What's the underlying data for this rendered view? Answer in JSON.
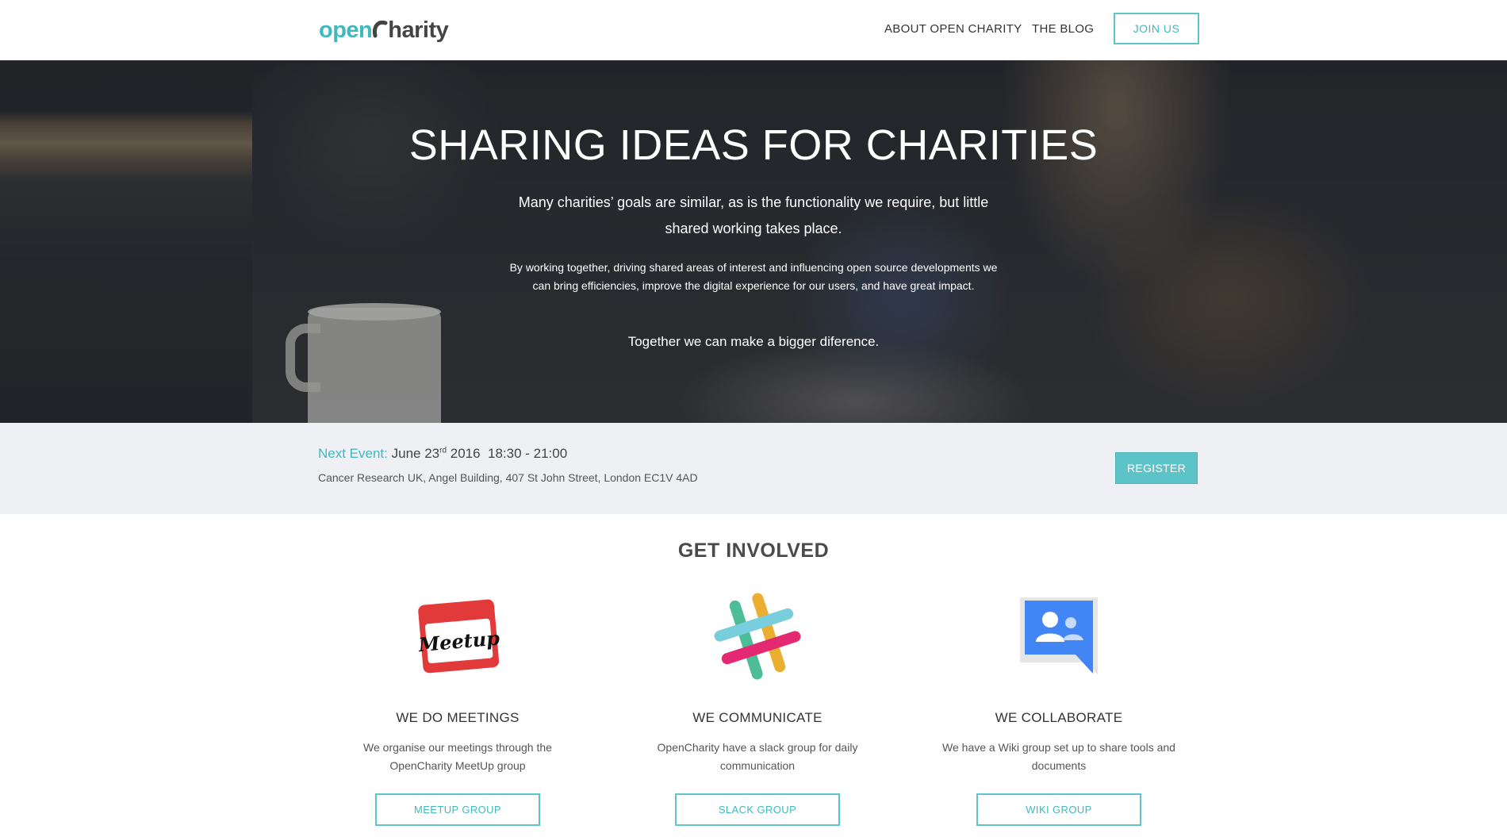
{
  "header": {
    "logo_part1": "open",
    "logo_part2": "harity",
    "nav": {
      "about": "ABOUT OPEN CHARITY",
      "blog": "THE BLOG",
      "join": "JOIN US"
    }
  },
  "hero": {
    "title": "SHARING IDEAS FOR CHARITIES",
    "subtitle": "Many charities’ goals are similar, as is the functionality we require, but little shared working takes place.",
    "body": "By working together, driving shared areas of interest and influencing open source developments we can bring efficiencies, improve the digital experience for our users, and have great impact.",
    "together": "Together we can make a bigger diference."
  },
  "event": {
    "label": "Next Event:",
    "date_day": "June 23",
    "date_suffix": "rd",
    "date_rest": " 2016  18:30 - 21:00",
    "address": "Cancer Research UK, Angel Building, 407 St John Street, London EC1V 4AD",
    "register": "REGISTER"
  },
  "involved": {
    "title": "GET INVOLVED",
    "columns": [
      {
        "icon": "meetup-icon",
        "icon_text": "Meetup",
        "title": "WE DO MEETINGS",
        "desc": "We organise our meetings through the OpenCharity MeetUp group",
        "button": "MEETUP GROUP"
      },
      {
        "icon": "slack-icon",
        "title": "WE COMMUNICATE",
        "desc": "OpenCharity have a slack group for daily communication",
        "button": "SLACK GROUP"
      },
      {
        "icon": "google-groups-icon",
        "title": "WE COLLABORATE",
        "desc": "We have a Wiki group set up to share tools and documents",
        "button": "WIKI GROUP"
      }
    ]
  },
  "colors": {
    "accent": "#3fb8c0",
    "event_bg": "#eff0f3",
    "register_bg": "#5cc3c9",
    "text": "#4a4a4a"
  }
}
